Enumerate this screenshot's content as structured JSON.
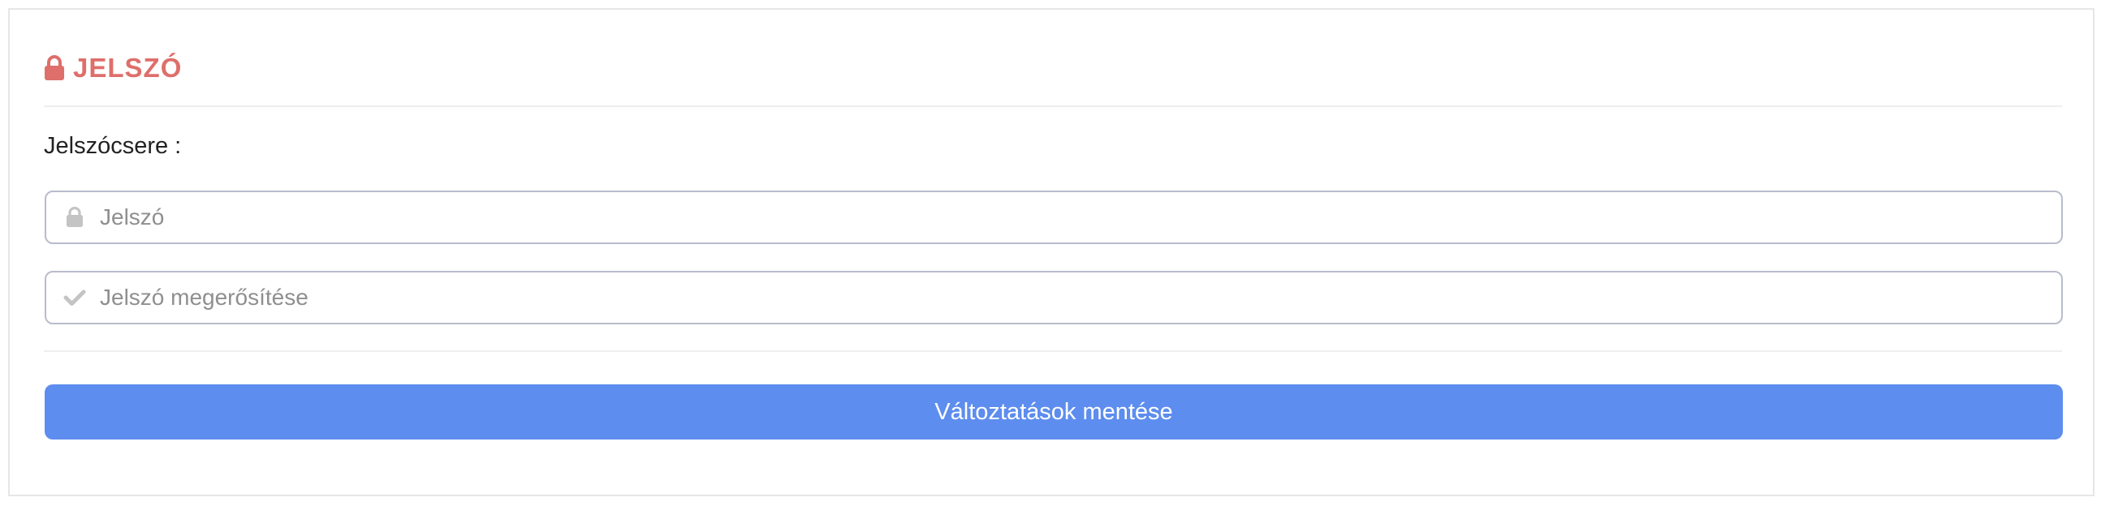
{
  "panel": {
    "title": "JELSZÓ",
    "title_icon": "lock-icon",
    "accent_color": "#de6f6a"
  },
  "section": {
    "label": "Jelszócsere :"
  },
  "fields": {
    "password": {
      "placeholder": "Jelszó",
      "value": "",
      "icon": "lock-icon"
    },
    "password_confirm": {
      "placeholder": "Jelszó megerősítése",
      "value": "",
      "icon": "check-icon"
    }
  },
  "actions": {
    "save_label": "Változtatások mentése",
    "save_color": "#5d8dee"
  }
}
